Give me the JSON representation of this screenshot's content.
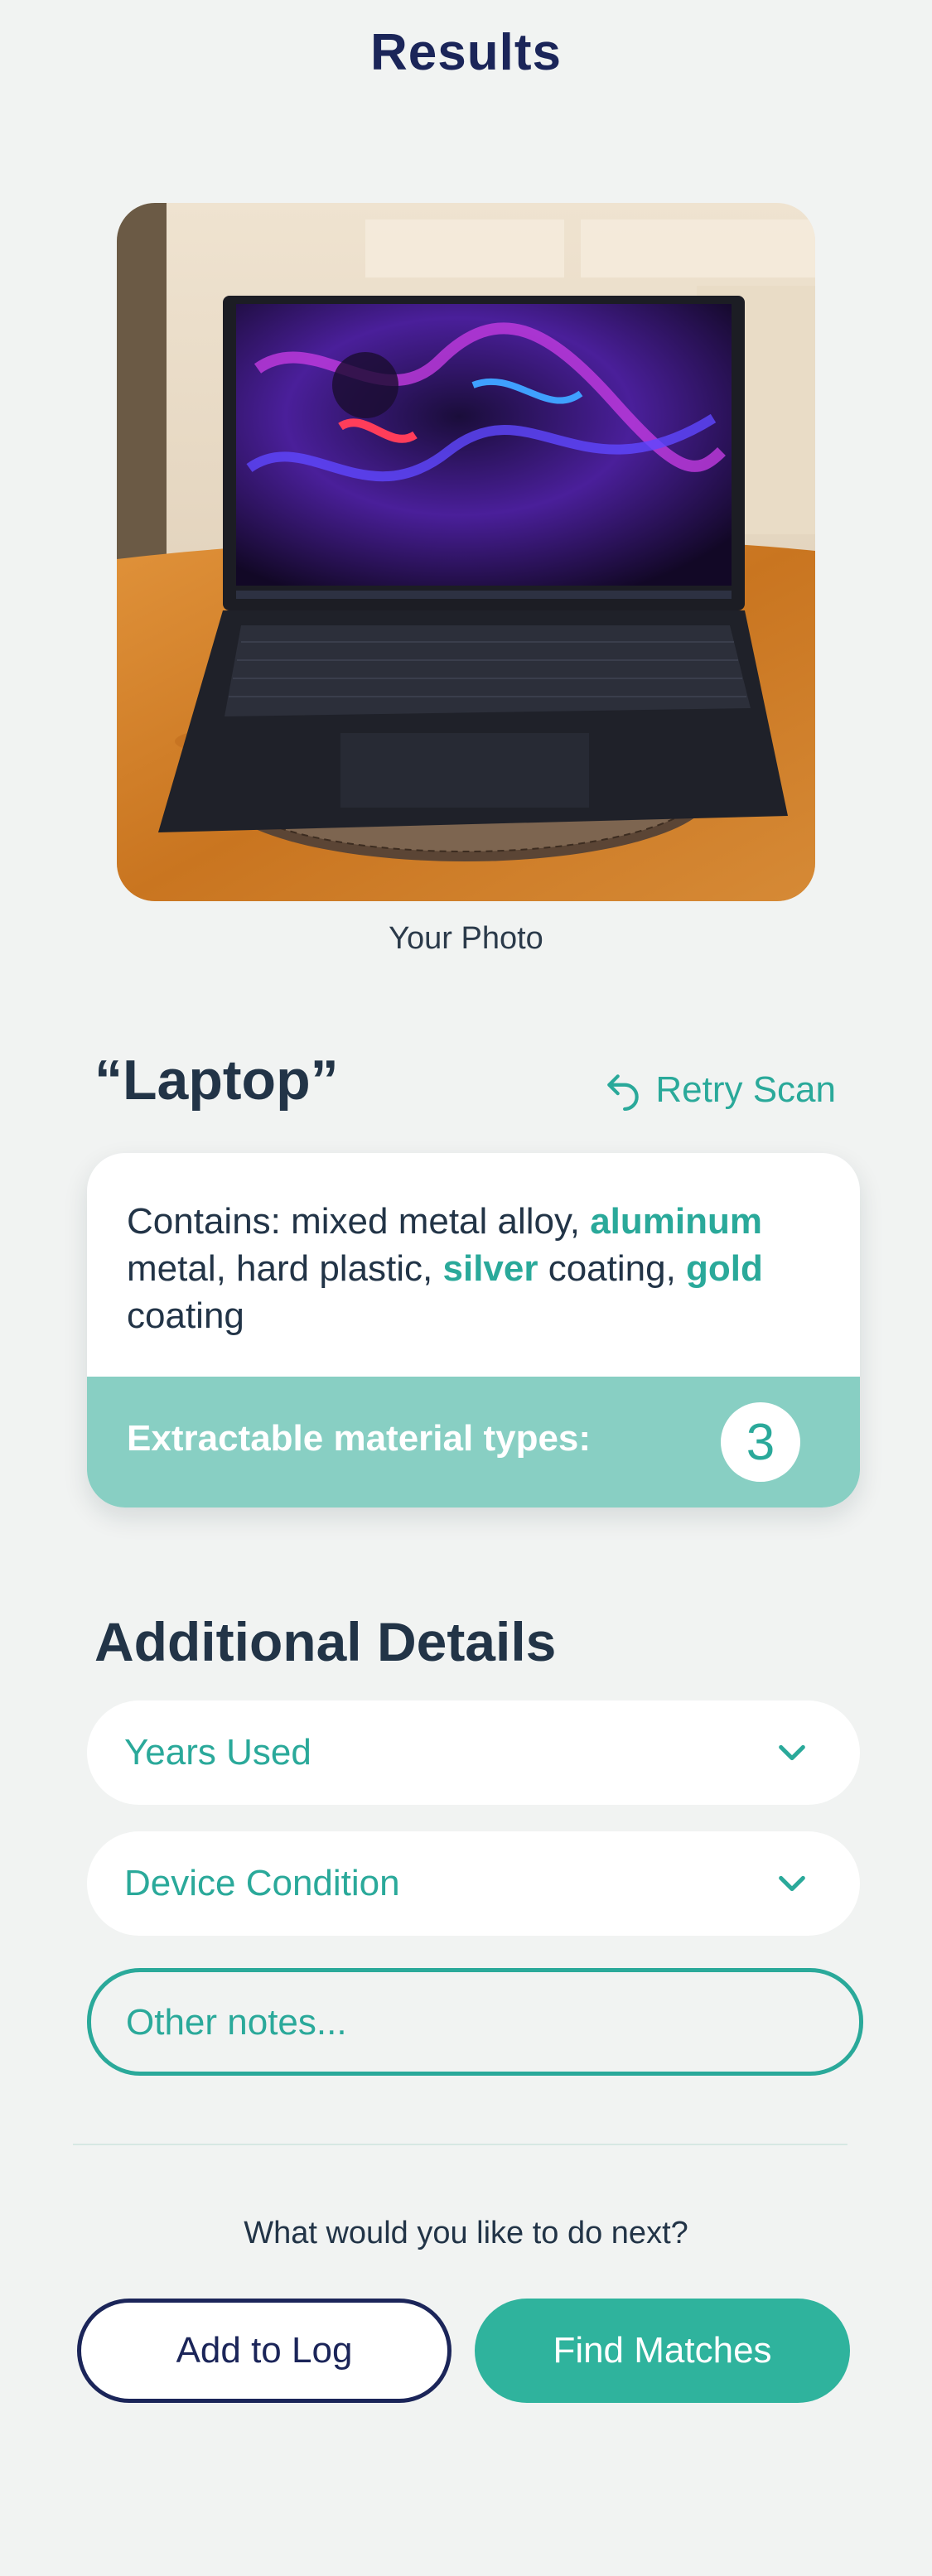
{
  "header": {
    "title": "Results"
  },
  "photo": {
    "caption": "Your Photo"
  },
  "item": {
    "name": "“Laptop”",
    "retry_label": "Retry Scan"
  },
  "materials": {
    "contains_prefix": "Contains: mixed metal alloy, ",
    "highlight_1": "aluminum",
    "text_2": " metal, hard plastic, ",
    "highlight_2": "silver",
    "text_3": " coating, ",
    "highlight_3": "gold",
    "text_4": " coating",
    "extractable_label": "Extractable material types:",
    "extractable_count": "3"
  },
  "details": {
    "title": "Additional Details",
    "years_used_label": "Years Used",
    "condition_label": "Device Condition",
    "notes_placeholder": "Other notes..."
  },
  "next": {
    "question": "What would you like to do next?",
    "add_to_log_label": "Add to Log",
    "find_matches_label": "Find Matches"
  },
  "colors": {
    "accent": "#2aa99a",
    "navy": "#1b2559",
    "card_footer": "#88cfc3",
    "background": "#f1f3f2"
  }
}
